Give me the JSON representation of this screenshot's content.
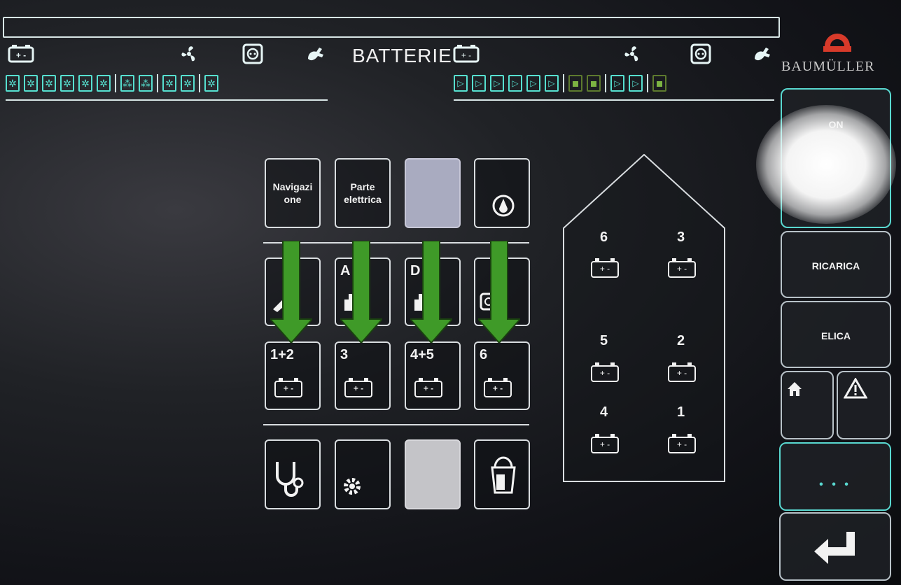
{
  "header": {
    "title": "BATTERIE",
    "brand": "BAUMÜLLER",
    "icons": {
      "battery": "battery-icon",
      "fan": "fan-icon",
      "socket": "socket-icon",
      "plug": "plug-icon"
    }
  },
  "status_left": {
    "cells": [
      "fan-cell",
      "fan-cell",
      "fan-cell",
      "fan-cell",
      "fan-cell",
      "fan-cell",
      "fan-cell-partial",
      "fan-cell-partial",
      "fan-cell",
      "fan-cell",
      "fan-cell"
    ]
  },
  "status_right": {
    "cells": [
      "play-cell",
      "play-cell",
      "play-cell",
      "play-cell",
      "play-cell",
      "play-cell",
      "green-led",
      "green-led",
      "play-cell",
      "play-cell",
      "green-led"
    ]
  },
  "grid": {
    "row1": [
      {
        "label": "Navigazi\none"
      },
      {
        "label": "Parte\nelettrica"
      },
      {
        "label": ""
      },
      {
        "label": ""
      }
    ],
    "row2": [
      {
        "label": ""
      },
      {
        "label": "A"
      },
      {
        "label": "D"
      },
      {
        "label": ""
      }
    ],
    "row3": [
      {
        "number": "1+2"
      },
      {
        "number": "3"
      },
      {
        "number": "4+5"
      },
      {
        "number": "6"
      }
    ],
    "battery_symbol": "+ -"
  },
  "house_diagram": {
    "batteries": [
      {
        "number": "6"
      },
      {
        "number": "3"
      },
      {
        "number": "5"
      },
      {
        "number": "2"
      },
      {
        "number": "4"
      },
      {
        "number": "1"
      }
    ]
  },
  "sidebar": {
    "top_label": "ON",
    "ricarica": "RICARICA",
    "elica": "ELICA",
    "more": "• • •"
  },
  "colors": {
    "accent_teal": "#56e0d0",
    "arrow_green": "#3f9a28",
    "brand_red": "#d83a2a"
  }
}
